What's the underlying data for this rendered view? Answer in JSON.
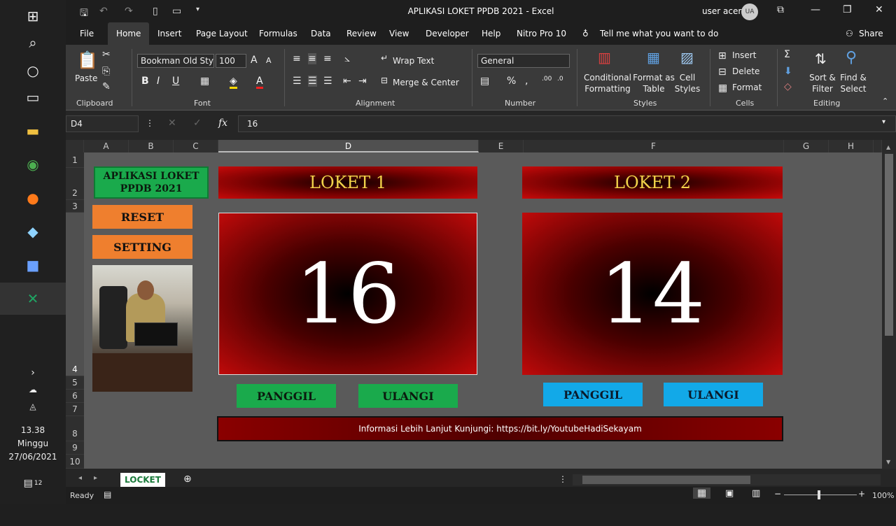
{
  "taskbar": {
    "time": "13.38",
    "day": "Minggu",
    "date": "27/06/2021",
    "notification_count": "12"
  },
  "window": {
    "title": "APLIKASI LOKET PPDB 2021  -  Excel",
    "user": "user acer",
    "avatar": "UA"
  },
  "menu": {
    "items": [
      "File",
      "Home",
      "Insert",
      "Page Layout",
      "Formulas",
      "Data",
      "Review",
      "View",
      "Developer",
      "Help",
      "Nitro Pro 10"
    ],
    "tell_me": "Tell me what you want to do",
    "share": "Share"
  },
  "ribbon": {
    "paste": "Paste",
    "clipboard": "Clipboard",
    "font_name": "Bookman Old Styl",
    "font_size": "100",
    "font": "Font",
    "wrap_text": "Wrap Text",
    "merge_center": "Merge & Center",
    "alignment": "Alignment",
    "number_format": "General",
    "number": "Number",
    "conditional_formatting": [
      "Conditional",
      "Formatting"
    ],
    "format_as_table": [
      "Format as",
      "Table"
    ],
    "cell_styles": [
      "Cell",
      "Styles"
    ],
    "styles": "Styles",
    "insert": "Insert",
    "delete": "Delete",
    "format": "Format",
    "cells": "Cells",
    "sort_filter": [
      "Sort &",
      "Filter"
    ],
    "find_select": [
      "Find &",
      "Select"
    ],
    "editing": "Editing"
  },
  "formula_bar": {
    "name_box": "D4",
    "fx": "fx",
    "value": "16"
  },
  "columns": [
    "A",
    "B",
    "C",
    "D",
    "E",
    "F",
    "G",
    "H"
  ],
  "rows": [
    "1",
    "2",
    "3",
    "4",
    "5",
    "6",
    "7",
    "8",
    "9",
    "10"
  ],
  "sheet": {
    "app_title": [
      "APLIKASI LOKET",
      "PPDB 2021"
    ],
    "reset": "RESET",
    "setting": "SETTING",
    "loket1": {
      "title": "LOKET 1",
      "number": "16",
      "panggil": "PANGGIL",
      "ulangi": "ULANGI"
    },
    "loket2": {
      "title": "LOKET 2",
      "number": "14",
      "panggil": "PANGGIL",
      "ulangi": "ULANGI"
    },
    "info": "Informasi Lebih Lanjut Kunjungi: https://bit.ly/YoutubeHadiSekayam"
  },
  "tabs": {
    "active": "LOCKET"
  },
  "status": {
    "ready": "Ready",
    "zoom": "100%"
  },
  "colors": {
    "loket_red": "#c00a0a",
    "title_yellow": "#f2d34a",
    "green": "#1aaa4c",
    "orange": "#ef7f2e",
    "blue": "#12a9e8"
  }
}
